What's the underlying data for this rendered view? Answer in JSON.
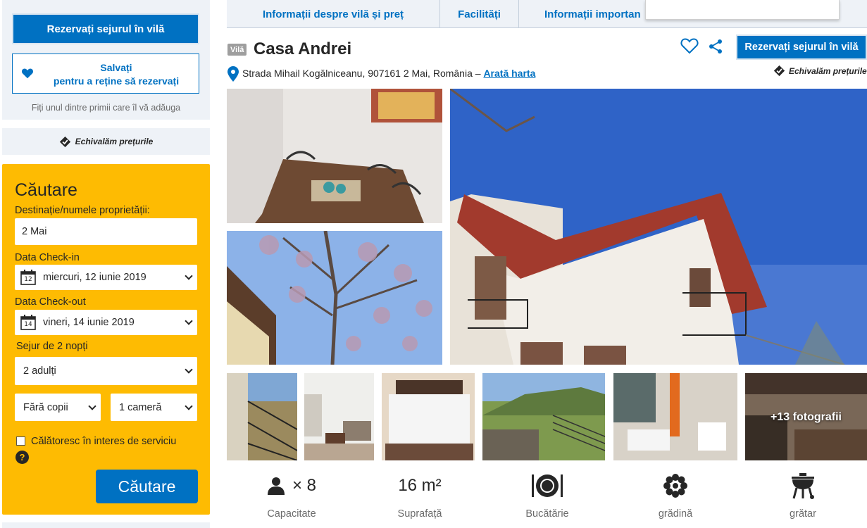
{
  "sidebar": {
    "reserve_label": "Rezervați sejurul în vilă",
    "save_line1": "Salvați",
    "save_line2": "pentru a reține să rezervați",
    "first_text": "Fiți unul dintre primii care îl vă adăuga",
    "price_match": "Echivalăm prețurile"
  },
  "search": {
    "title": "Căutare",
    "destination_label": "Destinație/numele proprietății:",
    "destination_value": "2 Mai",
    "checkin_label": "Data Check-in",
    "checkin_day": "12",
    "checkin_value": "miercuri, 12 iunie 2019",
    "checkout_label": "Data Check-out",
    "checkout_day": "14",
    "checkout_value": "vineri, 14 iunie 2019",
    "stay_label": "Sejur de 2 nopți",
    "adults_value": "2 adulți",
    "children_value": "Fără copii",
    "rooms_value": "1 cameră",
    "business_label": "Călătoresc în interes de serviciu",
    "help_glyph": "?",
    "search_button": "Căutare"
  },
  "tabs": [
    {
      "label": "Informații despre vilă și preț"
    },
    {
      "label": "Facilități"
    },
    {
      "label": "Informații importan"
    }
  ],
  "property": {
    "type_badge": "Vilă",
    "name": "Casa Andrei",
    "address": "Strada Mihail Kogălniceanu, 907161 2 Mai, România –",
    "map_link": "Arată harta",
    "reserve_label": "Rezervați sejurul în vilă",
    "price_match": "Echivalăm prețurile"
  },
  "gallery": {
    "more_photos": "+13 fotografii"
  },
  "facilities": [
    {
      "icon": "person-icon",
      "value": "× 8",
      "label": "Capacitate"
    },
    {
      "icon": "",
      "value": "16 m²",
      "label": "Suprafață"
    },
    {
      "icon": "kitchen-icon",
      "value": "",
      "label": "Bucătărie"
    },
    {
      "icon": "flower-icon",
      "value": "",
      "label": "grădină"
    },
    {
      "icon": "grill-icon",
      "value": "",
      "label": "grătar"
    }
  ],
  "colors": {
    "brand_blue": "#0071c2",
    "search_yellow": "#febb02",
    "panel_bg": "#eef2f7"
  }
}
